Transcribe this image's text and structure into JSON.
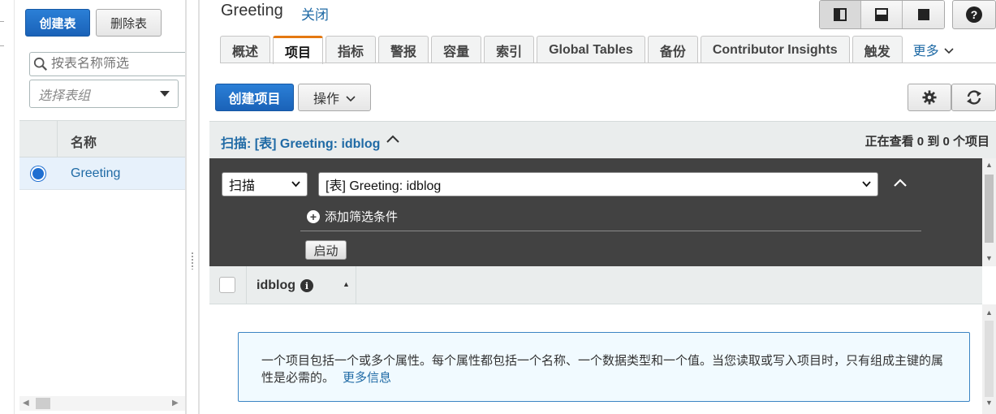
{
  "left": {
    "create_table": "创建表",
    "delete_table": "删除表",
    "filter_placeholder": "按表名称筛选",
    "group_placeholder": "选择表组",
    "table_header": "名称",
    "tables": [
      {
        "name": "Greeting",
        "selected": true
      }
    ]
  },
  "main": {
    "title": "Greeting",
    "close": "关闭",
    "help": "?",
    "tabs": [
      {
        "label": "概述",
        "active": false
      },
      {
        "label": "项目",
        "active": true
      },
      {
        "label": "指标",
        "active": false
      },
      {
        "label": "警报",
        "active": false
      },
      {
        "label": "容量",
        "active": false
      },
      {
        "label": "索引",
        "active": false
      },
      {
        "label": "Global Tables",
        "active": false
      },
      {
        "label": "备份",
        "active": false
      },
      {
        "label": "Contributor Insights",
        "active": false
      },
      {
        "label": "触发",
        "active": false
      }
    ],
    "more_tab": "更多",
    "create_item": "创建项目",
    "actions": "操作",
    "scan_title": "扫描: [表] Greeting: idblog",
    "view_count": "正在查看 0 到 0 个项目",
    "scan_mode": "扫描",
    "scan_target": "[表] Greeting: idblog",
    "add_filter": "添加筛选条件",
    "start": "启动",
    "column": "idblog",
    "info_text": "一个项目包括一个或多个属性。每个属性都包括一个名称、一个数据类型和一个值。当您读取或写入项目时，只有组成主键的属性是必需的。",
    "more_info": "更多信息"
  },
  "colors": {
    "primary": "#1a62b8",
    "link": "#1f6aa5",
    "active_tab_accent": "#e47911",
    "query_panel": "#424242",
    "info_bg": "#f1faff"
  }
}
